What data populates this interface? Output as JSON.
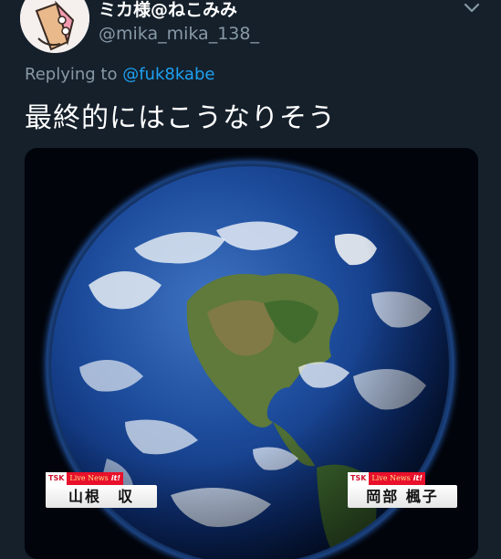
{
  "tweet": {
    "display_name": "ミカ様@ねこみみ",
    "handle": "@mika_mika_138_",
    "replying_prefix": "Replying to ",
    "replying_to": "@fuk8kabe",
    "text": "最終的にはこうなりそう"
  },
  "media": {
    "left_caption": {
      "station": "TSK",
      "program": "Live News",
      "program_suffix": "it!",
      "name": "山根　収"
    },
    "right_caption": {
      "station": "TSK",
      "program": "Live News",
      "program_suffix": "it!",
      "name": "岡部 楓子"
    }
  },
  "colors": {
    "background": "#15202b",
    "mention": "#1da1f2",
    "secondary_text": "#8899a6",
    "caption_red": "#e8102a"
  },
  "icons": {
    "menu": "chevron-down-icon",
    "avatar": "cat-avatar-illustration"
  }
}
